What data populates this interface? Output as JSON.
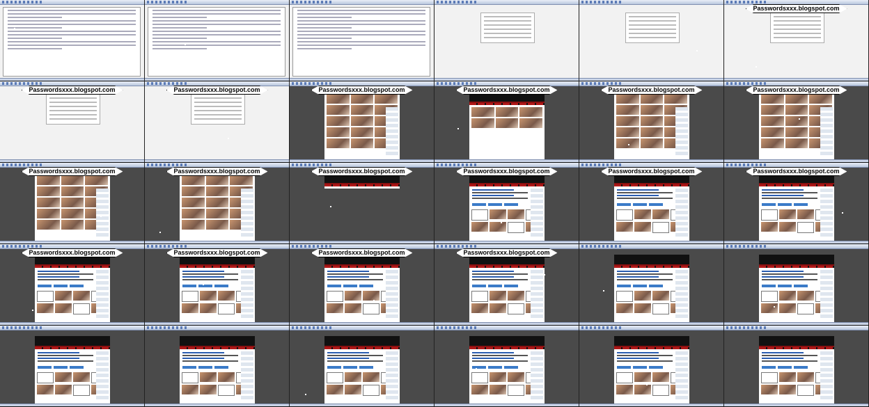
{
  "grid": {
    "rows": 5,
    "cols": 6
  },
  "watermark_text": "Passwordsxxx.blogspot.com",
  "frames": [
    {
      "view": "settings",
      "watermark": false
    },
    {
      "view": "settings",
      "watermark": false
    },
    {
      "view": "settings",
      "watermark": false
    },
    {
      "view": "dialog",
      "watermark": false
    },
    {
      "view": "dialog",
      "watermark": false
    },
    {
      "view": "dialog",
      "watermark": true
    },
    {
      "view": "dialog",
      "watermark": true
    },
    {
      "view": "dialog",
      "watermark": true
    },
    {
      "view": "gallery",
      "watermark": true
    },
    {
      "view": "banner",
      "watermark": true
    },
    {
      "view": "gallery",
      "watermark": true
    },
    {
      "view": "gallery",
      "watermark": true
    },
    {
      "view": "gallery",
      "watermark": true
    },
    {
      "view": "gallery",
      "watermark": true
    },
    {
      "view": "header",
      "watermark": true
    },
    {
      "view": "login",
      "watermark": true
    },
    {
      "view": "login",
      "watermark": true
    },
    {
      "view": "login",
      "watermark": true
    },
    {
      "view": "login",
      "watermark": true
    },
    {
      "view": "login",
      "watermark": true
    },
    {
      "view": "login",
      "watermark": true
    },
    {
      "view": "login",
      "watermark": true
    },
    {
      "view": "login",
      "watermark": false
    },
    {
      "view": "login",
      "watermark": false
    },
    {
      "view": "login",
      "watermark": false
    },
    {
      "view": "login",
      "watermark": false
    },
    {
      "view": "login",
      "watermark": false
    },
    {
      "view": "login",
      "watermark": false
    },
    {
      "view": "login",
      "watermark": false
    },
    {
      "view": "login",
      "watermark": false
    }
  ]
}
